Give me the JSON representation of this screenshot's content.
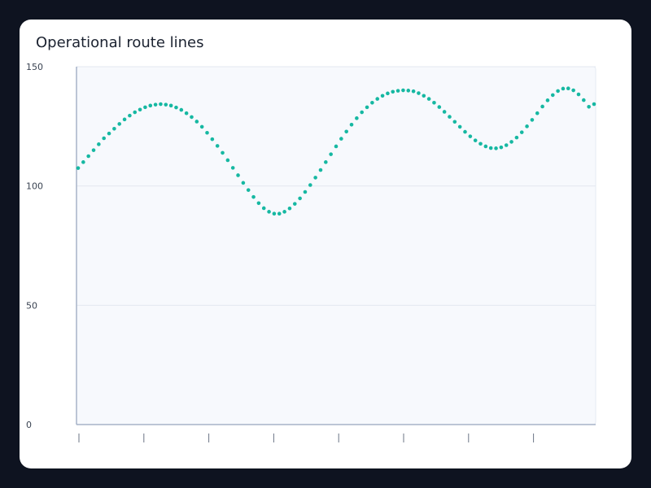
{
  "chart_data": {
    "type": "scatter",
    "title": "Operational route lines",
    "xlabel": "",
    "ylabel": "",
    "ylim": [
      0,
      150
    ],
    "yticks": [
      0,
      50,
      100,
      150
    ],
    "x_tick_count": 8,
    "grid": "horizontal",
    "colors": {
      "series": "#16b8a2",
      "plot_bg": "#f7f9fd",
      "axis": "#a7b3c8",
      "grid": "#e3e8f0"
    },
    "series": [
      {
        "x": [
          0,
          0.8,
          1.6,
          2.4,
          3.2,
          4,
          4.8,
          5.6,
          6.4,
          7.2,
          8,
          8.8,
          9.6,
          10.4,
          11.2,
          12,
          12.8,
          13.6,
          14.4,
          15.2,
          16,
          16.8,
          17.6,
          18.4,
          19.2,
          20,
          20.8,
          21.6,
          22.4,
          23.2,
          24,
          24.8,
          25.6,
          26.4,
          27.2,
          28,
          28.8,
          29.6,
          30.4,
          31.2,
          32,
          32.8,
          33.6,
          34.4,
          35.2,
          36,
          36.8,
          37.6,
          38.4,
          39.2,
          40,
          40.8,
          41.6,
          42.4,
          43.2,
          44,
          44.8,
          45.6,
          46.4,
          47.2,
          48,
          48.8,
          49.6,
          50.4,
          51.2,
          52,
          52.8,
          53.6,
          54.4,
          55.2,
          56,
          56.8,
          57.6,
          58.4,
          59.2,
          60,
          60.8,
          61.6,
          62.4,
          63.2,
          64,
          64.8,
          65.6,
          66.4,
          67.2,
          68,
          68.8,
          69.6,
          70.4,
          71.2,
          72,
          72.8,
          73.6,
          74.4,
          75.2,
          76,
          76.8,
          77.6,
          78.4,
          79.2,
          80
        ],
        "y": [
          107.5,
          110.0,
          112.5,
          115.0,
          117.5,
          120.0,
          122.0,
          124.0,
          126.0,
          127.9,
          129.5,
          130.9,
          132.0,
          133.0,
          133.7,
          134.1,
          134.3,
          134.1,
          133.7,
          132.9,
          131.9,
          130.5,
          128.9,
          127.0,
          124.8,
          122.3,
          119.6,
          116.8,
          113.9,
          110.8,
          107.6,
          104.5,
          101.3,
          98.3,
          95.4,
          92.8,
          90.7,
          89.2,
          88.4,
          88.4,
          89.2,
          90.6,
          92.5,
          94.8,
          97.5,
          100.4,
          103.5,
          106.7,
          110.0,
          113.3,
          116.6,
          119.8,
          122.8,
          125.7,
          128.4,
          130.9,
          133.0,
          134.9,
          136.5,
          137.8,
          138.8,
          139.5,
          139.9,
          140.1,
          140.0,
          139.7,
          138.9,
          137.8,
          136.5,
          134.9,
          133.1,
          131.1,
          129.0,
          126.9,
          124.8,
          122.7,
          120.8,
          119.1,
          117.7,
          116.6,
          115.9,
          115.8,
          116.2,
          117.1,
          118.5,
          120.3,
          122.5,
          125.0,
          127.7,
          130.5,
          133.3,
          135.9,
          138.1,
          139.8,
          140.8,
          140.9,
          140.1,
          138.4,
          136.0,
          133.2,
          134.3
        ]
      }
    ]
  }
}
